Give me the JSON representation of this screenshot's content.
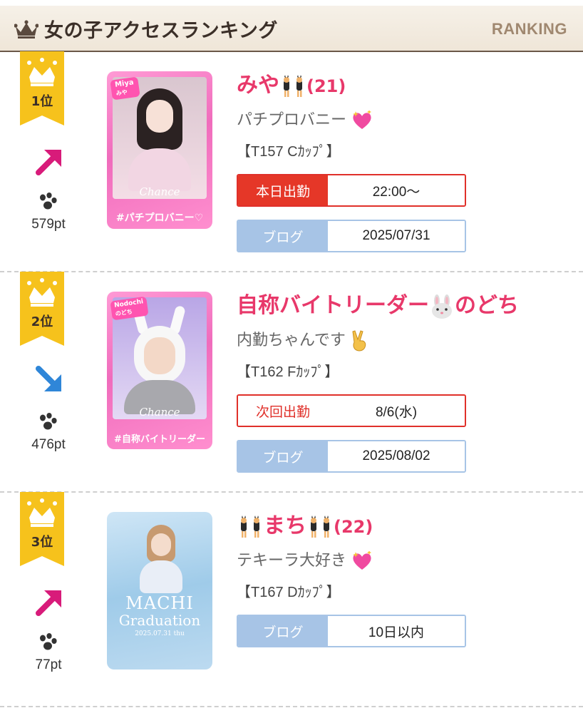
{
  "header": {
    "title": "女の子アクセスランキング",
    "subtitle": "RANKING"
  },
  "entries": [
    {
      "rank_label": "1位",
      "trend": "up",
      "points": "579pt",
      "photo": {
        "tag": "Miya",
        "tag_sub": "みや",
        "caption": "#パチプロバニー♡",
        "brand": "Chance"
      },
      "name": "みや",
      "age": "(21)",
      "catch": "パチプロバニー",
      "spec": "【T157 Cｶｯﾌﾟ】",
      "shift": {
        "type": "today",
        "label": "本日出勤",
        "value": "22:00〜"
      },
      "blog": {
        "label": "ブログ",
        "value": "2025/07/31"
      }
    },
    {
      "rank_label": "2位",
      "trend": "down",
      "points": "476pt",
      "photo": {
        "tag": "Nodochi",
        "tag_sub": "のどち",
        "caption": "#自称バイトリーダー",
        "brand": "Chance"
      },
      "name": "自称バイトリーダー",
      "name_suffix": "のどち",
      "catch": "内勤ちゃんです",
      "spec": "【T162 Fｶｯﾌﾟ】",
      "shift": {
        "type": "next",
        "label": "次回出勤",
        "value": "8/6(水)"
      },
      "blog": {
        "label": "ブログ",
        "value": "2025/08/02"
      }
    },
    {
      "rank_label": "3位",
      "trend": "up",
      "points": "77pt",
      "photo": {
        "line1": "MACHI",
        "line2": "Graduation",
        "line3": "2025.07.31 thu"
      },
      "name": "まち",
      "age": "(22)",
      "catch": "テキーラ大好き",
      "spec": "【T167 Dｶｯﾌﾟ】",
      "blog": {
        "label": "ブログ",
        "value": "10日以内"
      }
    }
  ],
  "colors": {
    "accent_pink": "#e8386a",
    "ribbon_yellow": "#f6c21c",
    "shift_red": "#e53728",
    "blog_blue": "#a7c4e6",
    "trend_up": "#d81b7a",
    "trend_down": "#2f86d8",
    "header_brown": "#6b5848"
  }
}
